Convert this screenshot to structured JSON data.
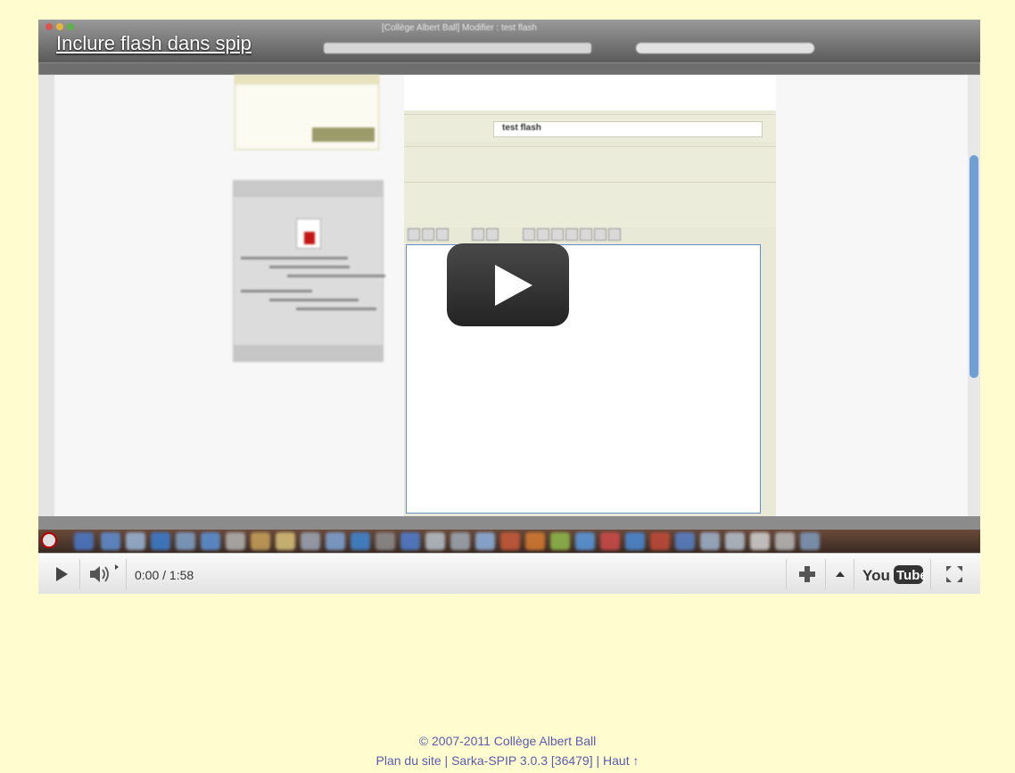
{
  "video": {
    "title": "Inclure flash dans spip",
    "time_display": "0:00 / 1:58",
    "screen": {
      "window_title": "[Collège Albert Ball] Modifier : test flash",
      "form_title_value": "test flash"
    },
    "controls": {
      "play_icon": "play-icon",
      "volume_icon": "volume-icon",
      "add_icon": "plus-icon",
      "expand_icon": "caret-up-icon",
      "fullscreen_icon": "fullscreen-icon",
      "logo": "YouTube"
    },
    "colors": {
      "accent": "#cc0000",
      "play_overlay": "#1b1b1b"
    }
  },
  "footer": {
    "copyright": "© 2007-2011 Collège Albert Ball",
    "links": [
      {
        "label": "Plan du site"
      },
      {
        "label": "Sarka-SPIP 3.0.3 [36479]"
      },
      {
        "label": "Haut ↑"
      }
    ],
    "separator": " | "
  },
  "colors": {
    "page_background": "#fffdd0",
    "footer_text": "#5a5ab0"
  }
}
